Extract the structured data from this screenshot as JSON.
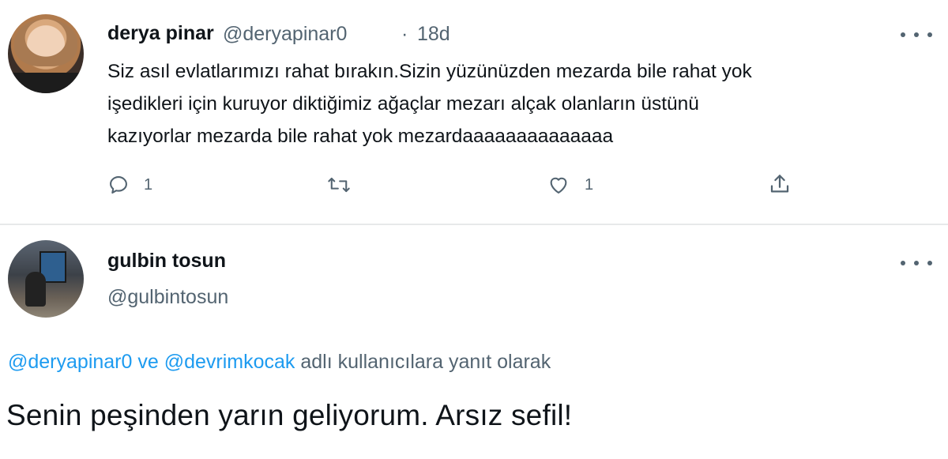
{
  "tweet1": {
    "author_name": "derya pinar",
    "author_handle": "@deryapinar0",
    "separator": "·",
    "time_ago": "18d",
    "text_lines": [
      "Siz asıl evlatlarımızı rahat bırakın.Sizin yüzünüzden mezarda bile rahat yok",
      "işedikleri için kuruyor diktiğimiz ağaçlar mezarı alçak olanların üstünü",
      "kazıyorlar mezarda bile rahat yok mezardaaaaaaaaaaaaaa"
    ],
    "reply_count": "1",
    "like_count": "1",
    "icons": {
      "reply": "reply-bubble-icon",
      "retweet": "retweet-icon",
      "like": "heart-icon",
      "share": "share-icon",
      "more": "more-dots-icon"
    }
  },
  "tweet2": {
    "author_name": "gulbin tosun",
    "author_handle": "@gulbintosun",
    "reply_to_mention_1": "@deryapinar0",
    "reply_to_conjunction": " ve ",
    "reply_to_mention_2": "@devrimkocak",
    "reply_to_suffix": " adlı kullanıcılara yanıt olarak",
    "text": "Senin peşinden yarın geliyorum. Arsız sefil!",
    "icons": {
      "more": "more-dots-icon"
    }
  },
  "colors": {
    "text_primary": "#0f1419",
    "text_secondary": "#536471",
    "link": "#1d9bf0",
    "divider": "#e7e9ea"
  }
}
